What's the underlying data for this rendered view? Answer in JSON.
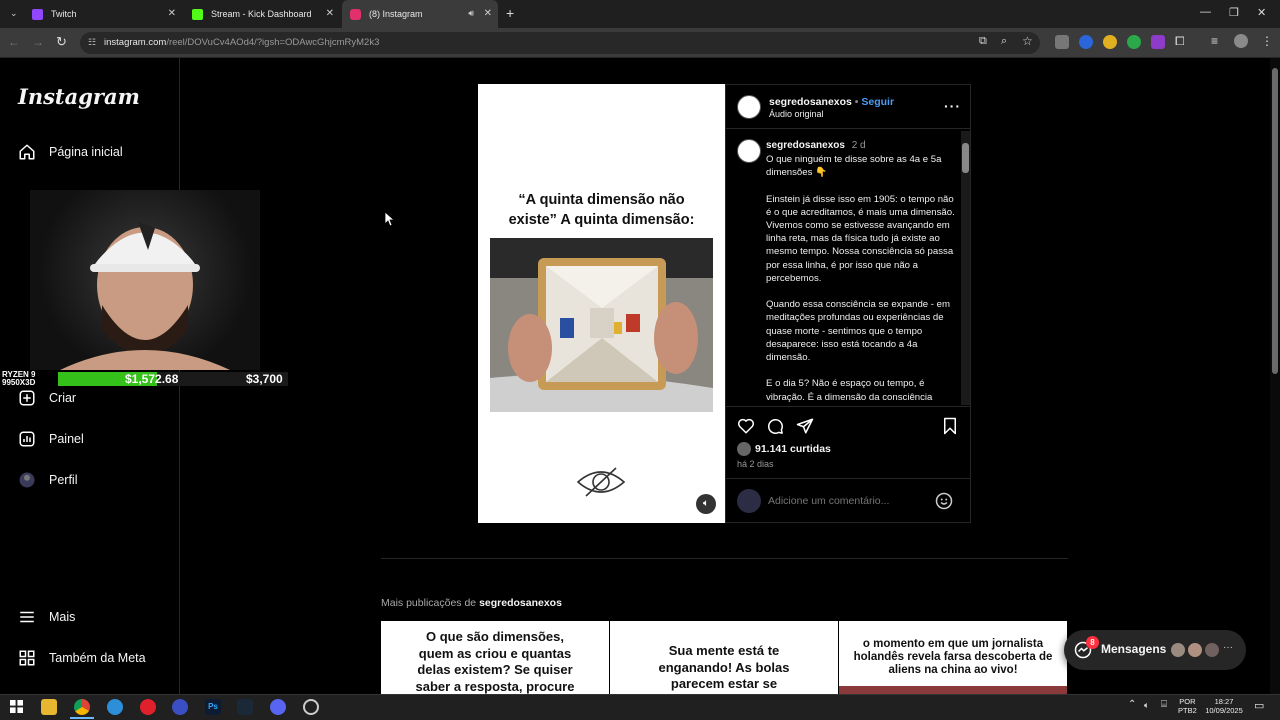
{
  "browser": {
    "tabs": [
      {
        "title": "Twitch",
        "color": "#9146ff"
      },
      {
        "title": "Stream - Kick Dashboard",
        "color": "#53fc18"
      },
      {
        "title": "(8) Instagram",
        "color": "#e1306c"
      }
    ],
    "url_main": "instagram.com",
    "url_rest": "/reel/DOVuCv4AOd4/?igsh=ODAwcGhjcmRyM2k3"
  },
  "sidebar": {
    "logo": "Instagram",
    "items": [
      {
        "label": "Página inicial",
        "icon": "home-icon"
      },
      {
        "label": "Criar",
        "icon": "create-icon"
      },
      {
        "label": "Painel",
        "icon": "dashboard-icon"
      },
      {
        "label": "Perfil",
        "icon": "profile-icon"
      }
    ],
    "more": "Mais",
    "meta": "Também da Meta"
  },
  "overlay": {
    "cpu_label": "RYZEN 9\n9950X3D",
    "progress_value": "$1,572.68",
    "goal_value": "$3,700",
    "progress_fraction": 0.43
  },
  "post": {
    "media_title": "“A quinta dimensão não existe” A quinta dimensão:",
    "username": "segredosanexos",
    "follow": "Seguir",
    "audio": "Áudio original",
    "caption_user": "segredosanexos",
    "caption_time": "2 d",
    "caption": "O que ninguém te disse sobre as 4a e 5a dimensões 👇\n\nEinstein já disse isso em 1905: o tempo não é o que acreditamos, é mais uma dimensão. Vivemos como se estivesse avançando em linha reta, mas da física tudo já existe ao mesmo tempo. Nossa consciência só passa por essa linha, é por isso que não a percebemos.\n\nQuando essa consciência se expande - em meditações profundas ou experiências de quase morte - sentimos que o tempo desaparece: isso está tocando a 4a dimensão.\n\nE o dia 5? Não é espaço ou tempo, é vibração. É a dimensão da consciência",
    "likes": "91.141 curtidas",
    "date": "há 2 dias",
    "comment_placeholder": "Adicione um comentário..."
  },
  "more_posts": {
    "prefix": "Mais publicações de ",
    "user": "segredosanexos",
    "cards": [
      "O que são dimensões, quem as criou e quantas delas existem? Se quiser saber a resposta, procure",
      "Sua mente está te enganando! As bolas parecem estar se",
      "o momento em que um jornalista holandês revela farsa descoberta de aliens na china ao vivo!"
    ]
  },
  "messages": {
    "label": "Mensagens",
    "badge": "8"
  },
  "taskbar": {
    "lang1": "POR",
    "lang2": "PTB2",
    "time": "18:27",
    "date": "10/09/2025"
  }
}
